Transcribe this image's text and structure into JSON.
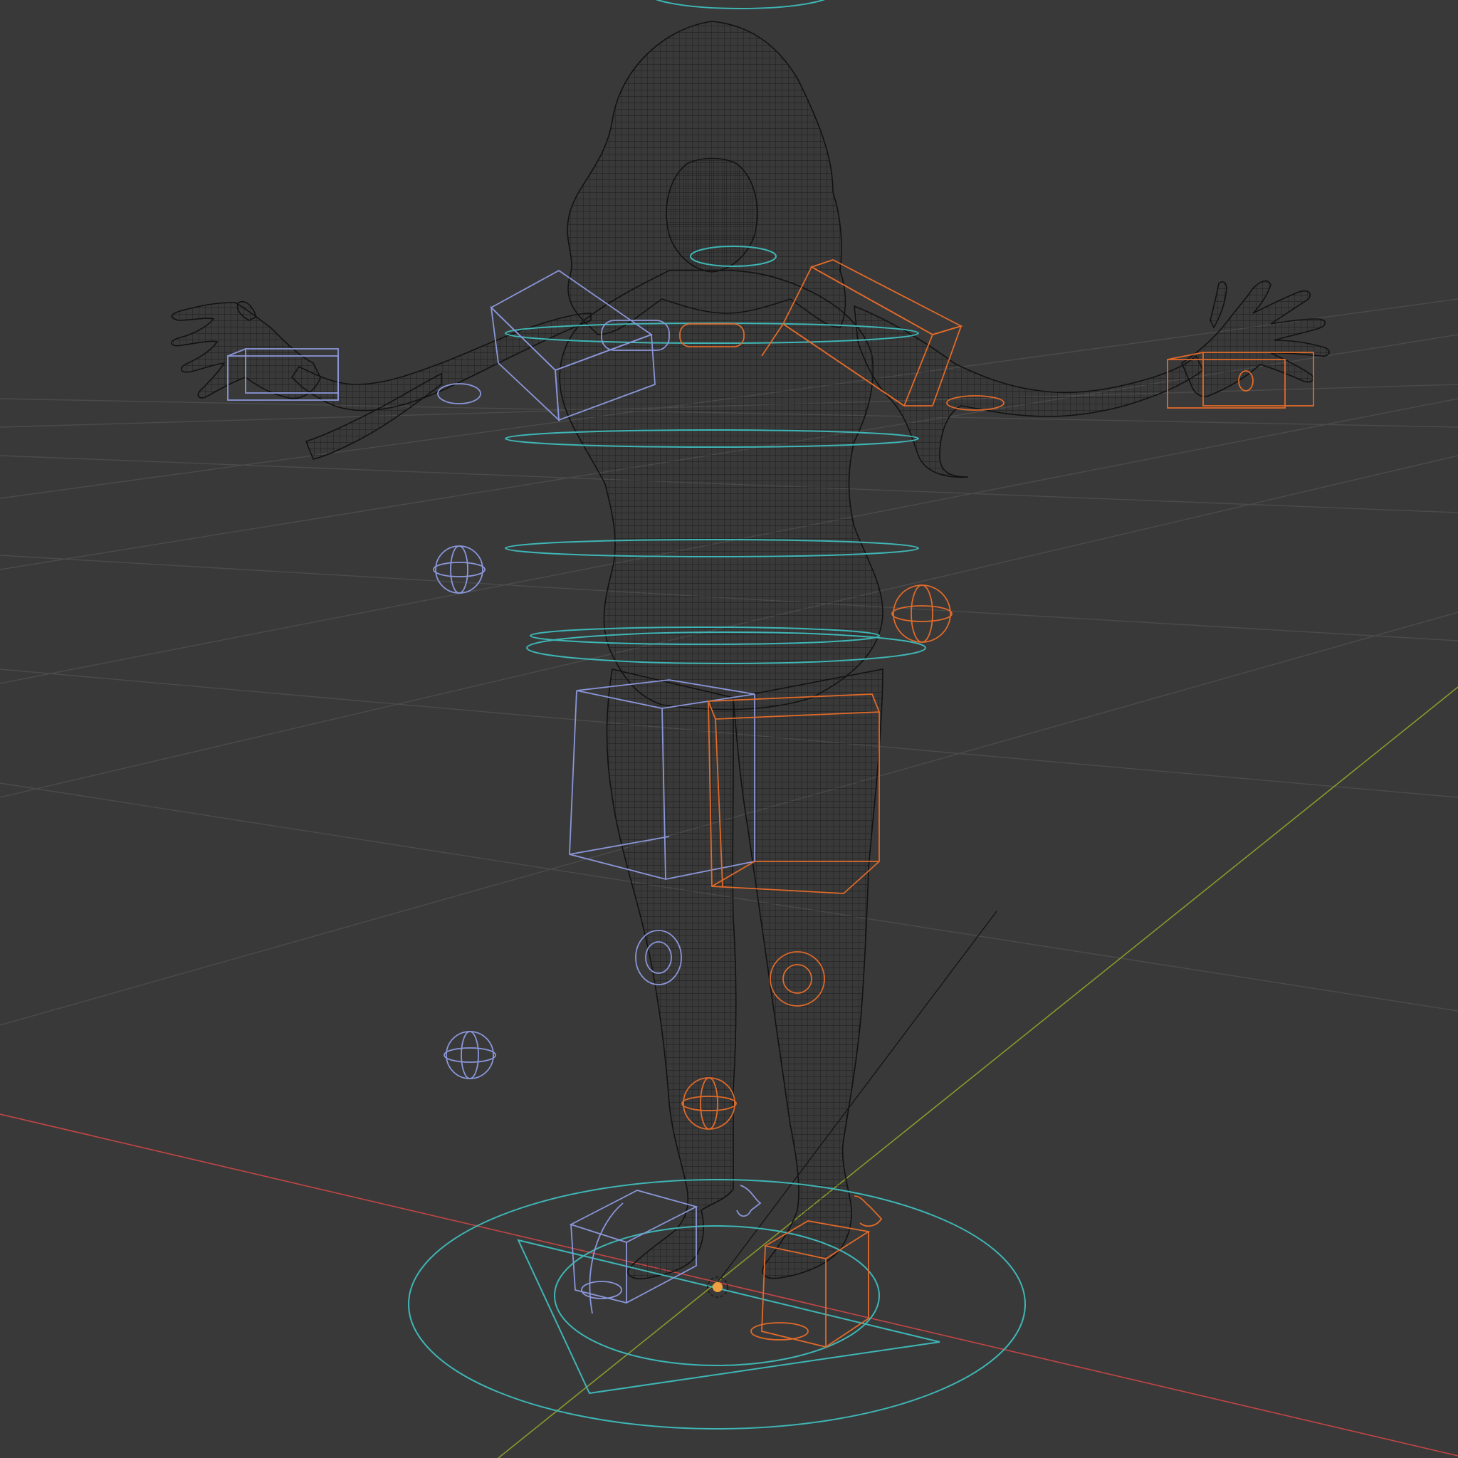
{
  "viewport": {
    "name": "3D Viewport",
    "shading": "wireframe",
    "background_color": "#393939"
  },
  "colors": {
    "grid": "#4a4a4a",
    "axis_x": "#c44545",
    "axis_y": "#8a9a2a",
    "mesh_wire": "#151515",
    "control_cyan": "#3fb6b6",
    "control_left": "#8a96d9",
    "control_right": "#e06a2a",
    "origin_marker": "#f0a040"
  },
  "scene": {
    "object": "character-mesh",
    "rig": "armature-controls",
    "icons": [
      "origin-icon"
    ]
  }
}
